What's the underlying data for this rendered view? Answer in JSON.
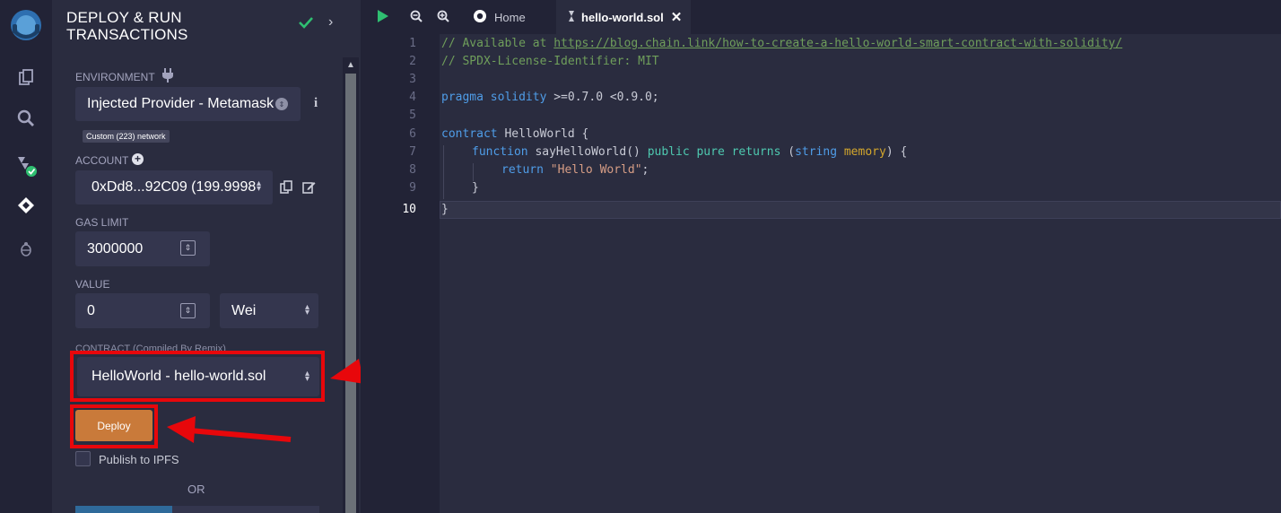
{
  "panel": {
    "title_line1": "DEPLOY & RUN",
    "title_line2": "TRANSACTIONS",
    "environment_label": "ENVIRONMENT",
    "environment_value": "Injected Provider - Metamask",
    "network_badge": "Custom (223) network",
    "account_label": "ACCOUNT",
    "account_value": "0xDd8...92C09 (199.9998",
    "gas_limit_label": "GAS LIMIT",
    "gas_limit_value": "3000000",
    "value_label": "VALUE",
    "value_amount": "0",
    "value_unit": "Wei",
    "contract_label": "CONTRACT (Compiled By Remix)",
    "contract_value": "HelloWorld - hello-world.sol",
    "deploy_label": "Deploy",
    "publish_label": "Publish to IPFS",
    "or_label": "OR"
  },
  "editor": {
    "home_tab": "Home",
    "file_tab": "hello-world.sol",
    "line_numbers": [
      "1",
      "2",
      "3",
      "4",
      "5",
      "6",
      "7",
      "8",
      "9",
      "10"
    ],
    "lines": {
      "l1_prefix": "// Available at ",
      "l1_url": "https://blog.chain.link/how-to-create-a-hello-world-smart-contract-with-solidity/",
      "l2": "// SPDX-License-Identifier: MIT",
      "l4_kw": "pragma solidity",
      "l4_rest": " >=0.7.0 <0.9.0;",
      "l6_kw": "contract",
      "l6_rest": " HelloWorld {",
      "l7_fn": "function",
      "l7_name": " sayHelloWorld() ",
      "l7_vis": "public pure returns",
      "l7_p1": " (",
      "l7_type": "string",
      "l7_mem": " memory",
      "l7_end": ") {",
      "l8_kw": "return",
      "l8_str": " \"Hello World\"",
      "l8_end": ";",
      "l9": "}",
      "l10": "}"
    }
  },
  "colors": {
    "accent_red": "#e8070b",
    "deploy_orange": "#c97a3a",
    "check_green": "#2fbf71"
  }
}
